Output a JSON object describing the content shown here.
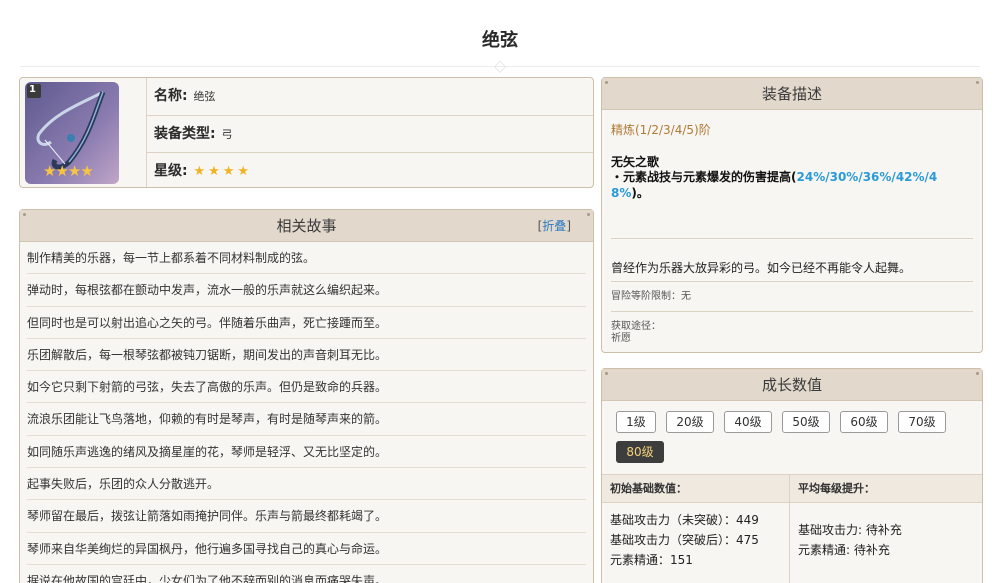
{
  "page": {
    "title": "绝弦"
  },
  "info": {
    "name_label": "名称:",
    "name_value": "绝弦",
    "type_label": "装备类型:",
    "type_value": "弓",
    "rarity_label": "星级:",
    "rarity_stars": "★★★★",
    "icon_badge": "1",
    "icon_stars": "★★★★",
    "rarity": 4
  },
  "story": {
    "title": "相关故事",
    "fold_open": "[",
    "fold_text": "折叠",
    "fold_close": "]",
    "lines": [
      "制作精美的乐器，每一节上都系着不同材料制成的弦。",
      "弹动时，每根弦都在颤动中发声，流水一般的乐声就这么编织起来。",
      "但同时也是可以射出追心之矢的弓。伴随着乐曲声，死亡接踵而至。",
      "乐团解散后，每一根琴弦都被钝刀锯断，期间发出的声音刺耳无比。",
      "如今它只剩下射箭的弓弦，失去了高傲的乐声。但仍是致命的兵器。",
      "流浪乐团能让飞鸟落地，仰赖的有时是琴声，有时是随琴声来的箭。",
      "如同随乐声逃逸的绪风及摘星崖的花，琴师是轻浮、又无比坚定的。",
      "起事失败后，乐团的众人分散逃开。",
      "琴师留在最后，拨弦让箭落如雨掩护同伴。乐声与箭最终都耗竭了。",
      "琴师来自华美绚烂的异国枫丹，他行遍多国寻找自己的真心与命运。",
      "据说在他故国的宫廷中，少女们为了他不辞而别的消息而痛哭失声。"
    ]
  },
  "description": {
    "title": "装备描述",
    "refine": "精炼(1/2/3/4/5)阶",
    "passive_name": "无矢之歌",
    "passive_prefix": "・元素战技与元素爆发的伤害提高(",
    "passive_values_line1": "24%/30%/36%/42%/4",
    "passive_values_line2": "8%",
    "passive_suffix": ")。",
    "flavor": "曾经作为乐器大放异彩的弓。如今已经不再能令人起舞。",
    "level_limit": "冒险等阶限制：无",
    "source_label": "获取途径：",
    "source_value": "祈愿"
  },
  "growth": {
    "title": "成长数值",
    "levels": [
      "1级",
      "20级",
      "40级",
      "50级",
      "60级",
      "70级",
      "80级"
    ],
    "active_level": "80级",
    "col_base": "初始基础数值：",
    "col_avg": "平均每级提升：",
    "base_atk_before": "基础攻击力（未突破）：449",
    "base_atk_after": "基础攻击力（突破后）：475",
    "elemental_mastery": "元素精通：151",
    "avg_atk": "基础攻击力: 待补充",
    "avg_em": "元素精通: 待补充"
  },
  "colors": {
    "panel_bg": "#f8f6f2",
    "header_bg": "#e2d9cc",
    "border": "#cdbfa9",
    "refine": "#b07a36",
    "highlight": "#2a9ad8",
    "star": "#f0b323",
    "active_tab_bg": "#3d3d3d",
    "active_tab_text": "#f3d27b"
  }
}
